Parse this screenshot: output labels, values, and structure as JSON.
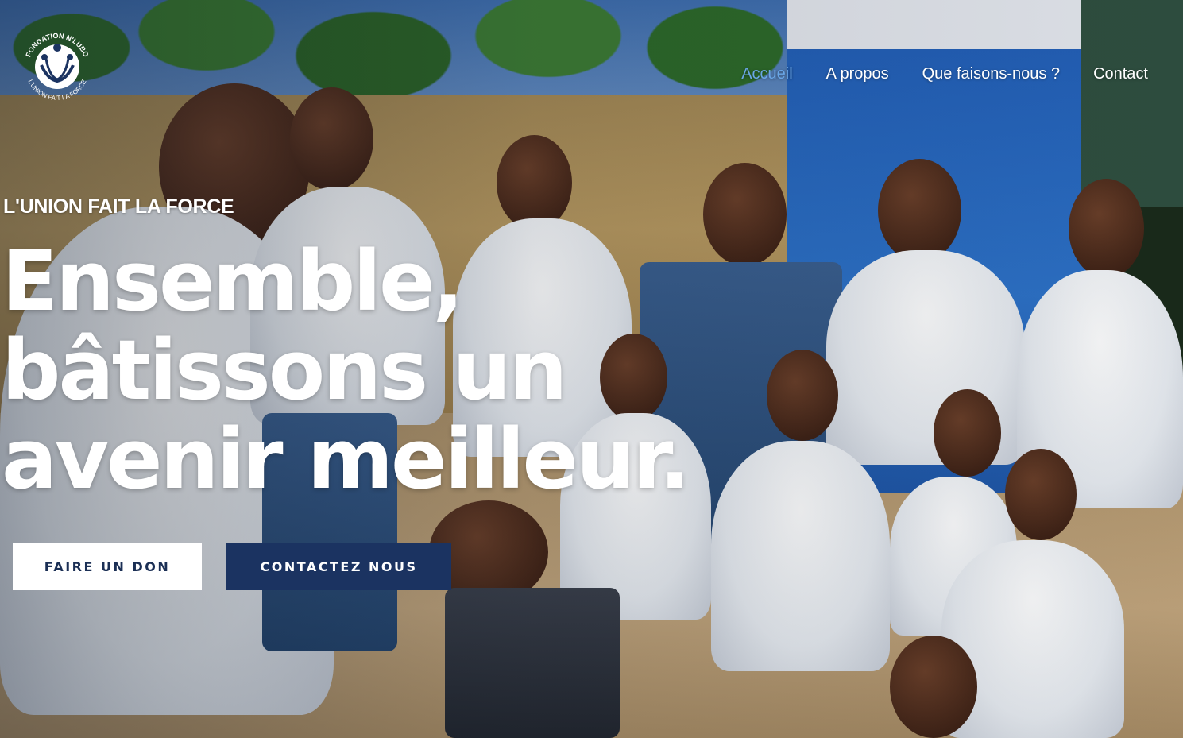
{
  "logo": {
    "icon": "fondation-logo-icon",
    "text_top": "FONDATION N'LUBO",
    "text_bottom": "L'UNION FAIT LA FORCE"
  },
  "nav": {
    "items": [
      {
        "label": "Accueil",
        "active": true
      },
      {
        "label": "A propos",
        "active": false
      },
      {
        "label": "Que faisons-nous ?",
        "active": false
      },
      {
        "label": "Contact",
        "active": false
      }
    ],
    "active_color": "#6aa6e6"
  },
  "hero": {
    "tagline": "L'UNION FAIT LA FORCE",
    "headline_line1": "Ensemble,",
    "headline_line2": "bâtissons un",
    "headline_line3": "avenir meilleur."
  },
  "buttons": {
    "donate_label": "FAIRE UN DON",
    "contact_label": "CONTACTEZ NOUS",
    "contact_bg": "#1b3361"
  }
}
